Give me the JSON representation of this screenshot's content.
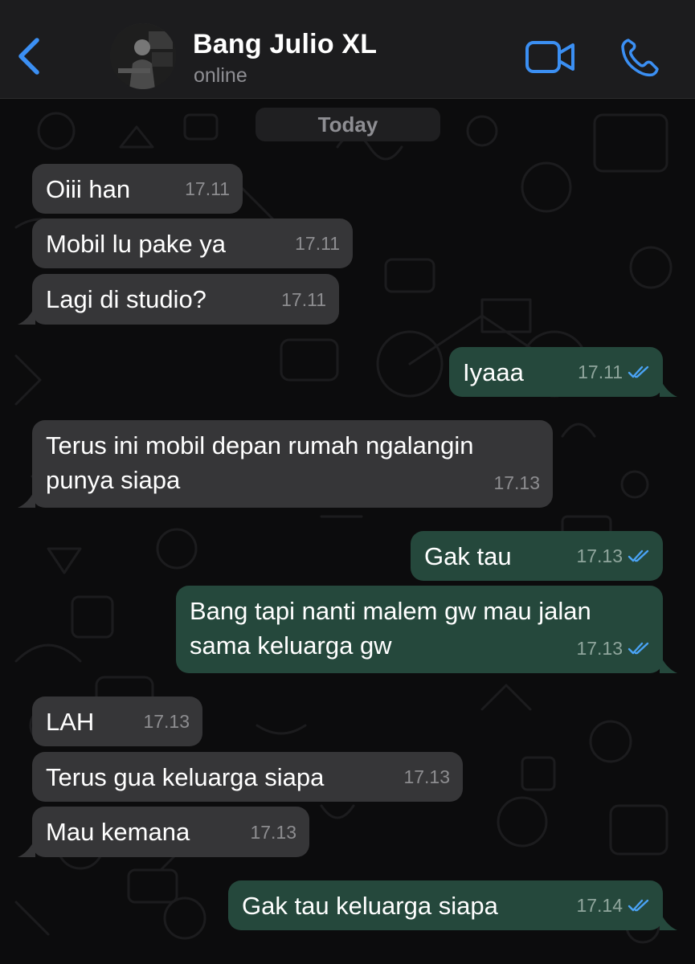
{
  "header": {
    "back_icon": "chevron-left-icon",
    "contact_name": "Bang Julio XL",
    "status": "online",
    "video_icon": "video-camera-icon",
    "call_icon": "phone-icon",
    "accent_color": "#3b8ff3"
  },
  "chat": {
    "date_label": "Today",
    "messages": [
      {
        "direction": "incoming",
        "text": "Oiii han",
        "time": "17.11"
      },
      {
        "direction": "incoming",
        "text": "Mobil lu pake ya",
        "time": "17.11"
      },
      {
        "direction": "incoming",
        "text": "Lagi di studio?",
        "time": "17.11"
      },
      {
        "direction": "outgoing",
        "text": "Iyaaa",
        "time": "17.11",
        "status": "read"
      },
      {
        "direction": "incoming",
        "line1": "Terus ini mobil depan rumah ngalangin",
        "line2": "punya siapa",
        "time": "17.13"
      },
      {
        "direction": "outgoing",
        "text": "Gak tau",
        "time": "17.13",
        "status": "read"
      },
      {
        "direction": "outgoing",
        "line1": "Bang tapi nanti malem gw mau jalan",
        "line2": "sama keluarga gw",
        "time": "17.13",
        "status": "read"
      },
      {
        "direction": "incoming",
        "text": "LAH",
        "time": "17.13"
      },
      {
        "direction": "incoming",
        "text": "Terus gua keluarga siapa",
        "time": "17.13"
      },
      {
        "direction": "incoming",
        "text": "Mau kemana",
        "time": "17.13"
      },
      {
        "direction": "outgoing",
        "text": "Gak tau keluarga siapa",
        "time": "17.14",
        "status": "read"
      }
    ]
  },
  "colors": {
    "incoming_bubble": "#363638",
    "outgoing_bubble": "#25483c",
    "read_ticks": "#4aa3f5"
  }
}
